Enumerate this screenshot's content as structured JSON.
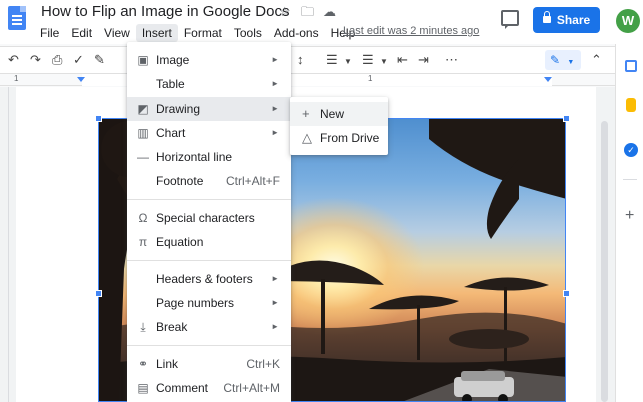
{
  "document": {
    "title": "How to Flip an Image in Google Docs",
    "last_edit": "Last edit was 2 minutes ago"
  },
  "menubar": [
    "File",
    "Edit",
    "View",
    "Insert",
    "Format",
    "Tools",
    "Add-ons",
    "Help"
  ],
  "share": {
    "label": "Share"
  },
  "account": {
    "initial": "W",
    "color": "#43a047"
  },
  "ruler": {
    "numbers": [
      "1",
      "1"
    ]
  },
  "insert_menu": {
    "items": [
      {
        "label": "Image",
        "icon": "image-icon",
        "submenu": true
      },
      {
        "label": "Table",
        "icon": "",
        "submenu": true
      },
      {
        "label": "Drawing",
        "icon": "drawing-icon",
        "submenu": true,
        "highlighted": true
      },
      {
        "label": "Chart",
        "icon": "chart-icon",
        "submenu": true
      },
      {
        "label": "Horizontal line",
        "icon": "horizontal-line-icon"
      },
      {
        "label": "Footnote",
        "shortcut": "Ctrl+Alt+F"
      },
      {
        "label": "Special characters",
        "icon": "omega-icon"
      },
      {
        "label": "Equation",
        "icon": "pi-icon"
      },
      {
        "label": "Headers & footers",
        "submenu": true
      },
      {
        "label": "Page numbers",
        "submenu": true
      },
      {
        "label": "Break",
        "icon": "break-icon",
        "submenu": true
      },
      {
        "label": "Link",
        "icon": "link-icon",
        "shortcut": "Ctrl+K"
      },
      {
        "label": "Comment",
        "icon": "comment-icon",
        "shortcut": "Ctrl+Alt+M"
      }
    ]
  },
  "drawing_submenu": {
    "items": [
      {
        "label": "New",
        "icon": "plus-icon"
      },
      {
        "label": "From Drive",
        "icon": "drive-icon"
      }
    ]
  },
  "colors": {
    "accent": "#1a73e8",
    "share_button": "#1a73e8"
  }
}
